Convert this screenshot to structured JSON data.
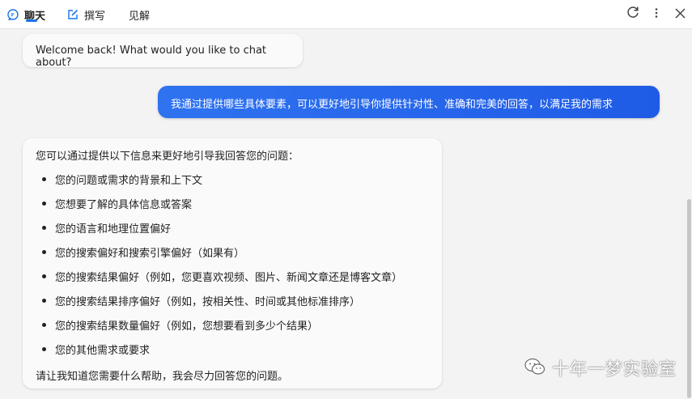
{
  "tabs": [
    {
      "label": "聊天",
      "icon": "chat-bubble-icon",
      "active": true
    },
    {
      "label": "撰写",
      "icon": "edit-icon",
      "active": false
    },
    {
      "label": "见解",
      "icon": "",
      "active": false
    }
  ],
  "toolbar": {
    "refresh_icon": "refresh-icon",
    "more_icon": "more-vertical-icon",
    "close_icon": "close-icon"
  },
  "messages": {
    "welcome": "Welcome back! What would you like to chat about?",
    "user_question": "我通过提供哪些具体要素，可以更好地引导你提供针对性、准确和完美的回答，以满足我的需求",
    "answer": {
      "intro": "您可以通过提供以下信息来更好地引导我回答您的问题：",
      "items": [
        "您的问题或需求的背景和上下文",
        "您想要了解的具体信息或答案",
        "您的语言和地理位置偏好",
        "您的搜索偏好和搜索引擎偏好（如果有）",
        "您的搜索结果偏好（例如，您更喜欢视频、图片、新闻文章还是博客文章）",
        "您的搜索结果排序偏好（例如，按相关性、时间或其他标准排序）",
        "您的搜索结果数量偏好（例如，您想要看到多少个结果）",
        "您的其他需求或要求"
      ],
      "outro": "请让我知道您需要什么帮助，我会尽力回答您的问题。"
    }
  },
  "watermark": "十年一梦实验室",
  "colors": {
    "accent": "#1a73e8",
    "user_bubble": "#2f73f0",
    "background": "#f3f3f3"
  }
}
